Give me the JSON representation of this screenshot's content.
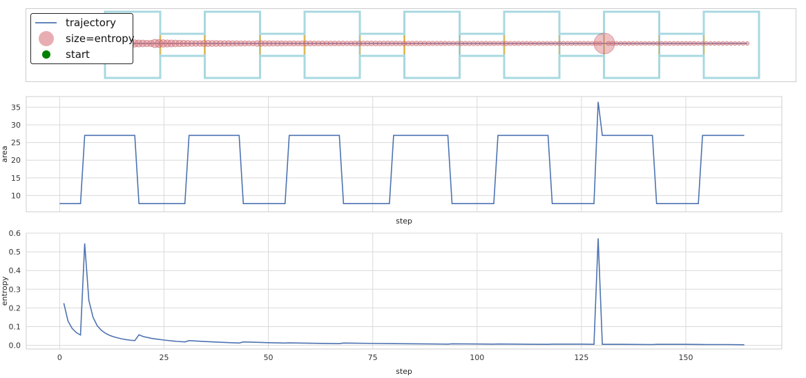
{
  "chart_data": [
    {
      "type": "scatter",
      "panel": "maze-trajectory",
      "legend": {
        "placement": "top-left",
        "entries": [
          {
            "key": "trajectory",
            "label": "trajectory",
            "marker": "line",
            "color": "#4c72b0"
          },
          {
            "key": "size",
            "label": "size=entropy",
            "marker": "circle",
            "color": "#d9777e"
          },
          {
            "key": "start",
            "label": "start",
            "marker": "circle",
            "color": "#008000"
          }
        ]
      },
      "colors": {
        "walls": "#a8d8e0",
        "openings": "#ffa500",
        "path": "#4c72b0",
        "points": "#d9777e",
        "start": "#008000"
      },
      "grid": false,
      "rooms": 7,
      "corridors": 6,
      "start_x": 0.2,
      "big_point_step": 129
    },
    {
      "type": "line",
      "panel": "area",
      "xlabel": "step",
      "ylabel": "area",
      "xlim": [
        -8,
        173
      ],
      "ylim": [
        5.4,
        38
      ],
      "xticks": [
        0,
        25,
        50,
        75,
        100,
        125,
        150
      ],
      "yticks": [
        10,
        15,
        20,
        25,
        30,
        35
      ],
      "grid": true,
      "color": "#4c72b0",
      "series": [
        {
          "x": [
            0,
            5,
            6,
            18,
            19,
            30,
            31,
            43,
            44,
            54,
            55,
            67,
            68,
            79,
            80,
            93,
            94,
            104,
            105,
            117,
            118,
            128,
            129,
            130,
            142,
            143,
            153,
            154,
            164
          ],
          "values": [
            7.7,
            7.7,
            27,
            27,
            7.7,
            7.7,
            27,
            27,
            7.7,
            7.7,
            27,
            27,
            7.7,
            7.7,
            27,
            27,
            7.7,
            7.7,
            27,
            27,
            7.7,
            7.7,
            36.5,
            27,
            27,
            7.7,
            7.7,
            27,
            27
          ]
        }
      ]
    },
    {
      "type": "line",
      "panel": "entropy",
      "xlabel": "step",
      "ylabel": "entropy",
      "xlim": [
        -8,
        173
      ],
      "ylim": [
        -0.02,
        0.6
      ],
      "xticks": [
        0,
        25,
        50,
        75,
        100,
        125,
        150
      ],
      "yticks": [
        0.0,
        0.1,
        0.2,
        0.3,
        0.4,
        0.5,
        0.6
      ],
      "grid": true,
      "color": "#4c72b0",
      "series": [
        {
          "x": [
            1,
            2,
            3,
            4,
            5,
            6,
            7,
            8,
            9,
            10,
            11,
            12,
            13,
            14,
            15,
            16,
            17,
            18,
            19,
            20,
            22,
            25,
            28,
            30,
            31,
            35,
            40,
            43,
            44,
            50,
            54,
            55,
            60,
            67,
            68,
            75,
            80,
            90,
            93,
            94,
            100,
            104,
            105,
            110,
            117,
            118,
            125,
            128,
            129,
            130,
            135,
            142,
            143,
            150,
            155,
            160,
            164
          ],
          "values": [
            0.225,
            0.13,
            0.09,
            0.068,
            0.055,
            0.545,
            0.24,
            0.15,
            0.105,
            0.08,
            0.064,
            0.053,
            0.045,
            0.039,
            0.034,
            0.03,
            0.027,
            0.025,
            0.056,
            0.047,
            0.037,
            0.028,
            0.021,
            0.018,
            0.025,
            0.02,
            0.015,
            0.012,
            0.018,
            0.014,
            0.012,
            0.013,
            0.011,
            0.009,
            0.012,
            0.01,
            0.009,
            0.007,
            0.006,
            0.008,
            0.007,
            0.006,
            0.007,
            0.006,
            0.005,
            0.006,
            0.006,
            0.005,
            0.572,
            0.005,
            0.005,
            0.004,
            0.005,
            0.005,
            0.004,
            0.004,
            0.003
          ]
        }
      ]
    }
  ]
}
